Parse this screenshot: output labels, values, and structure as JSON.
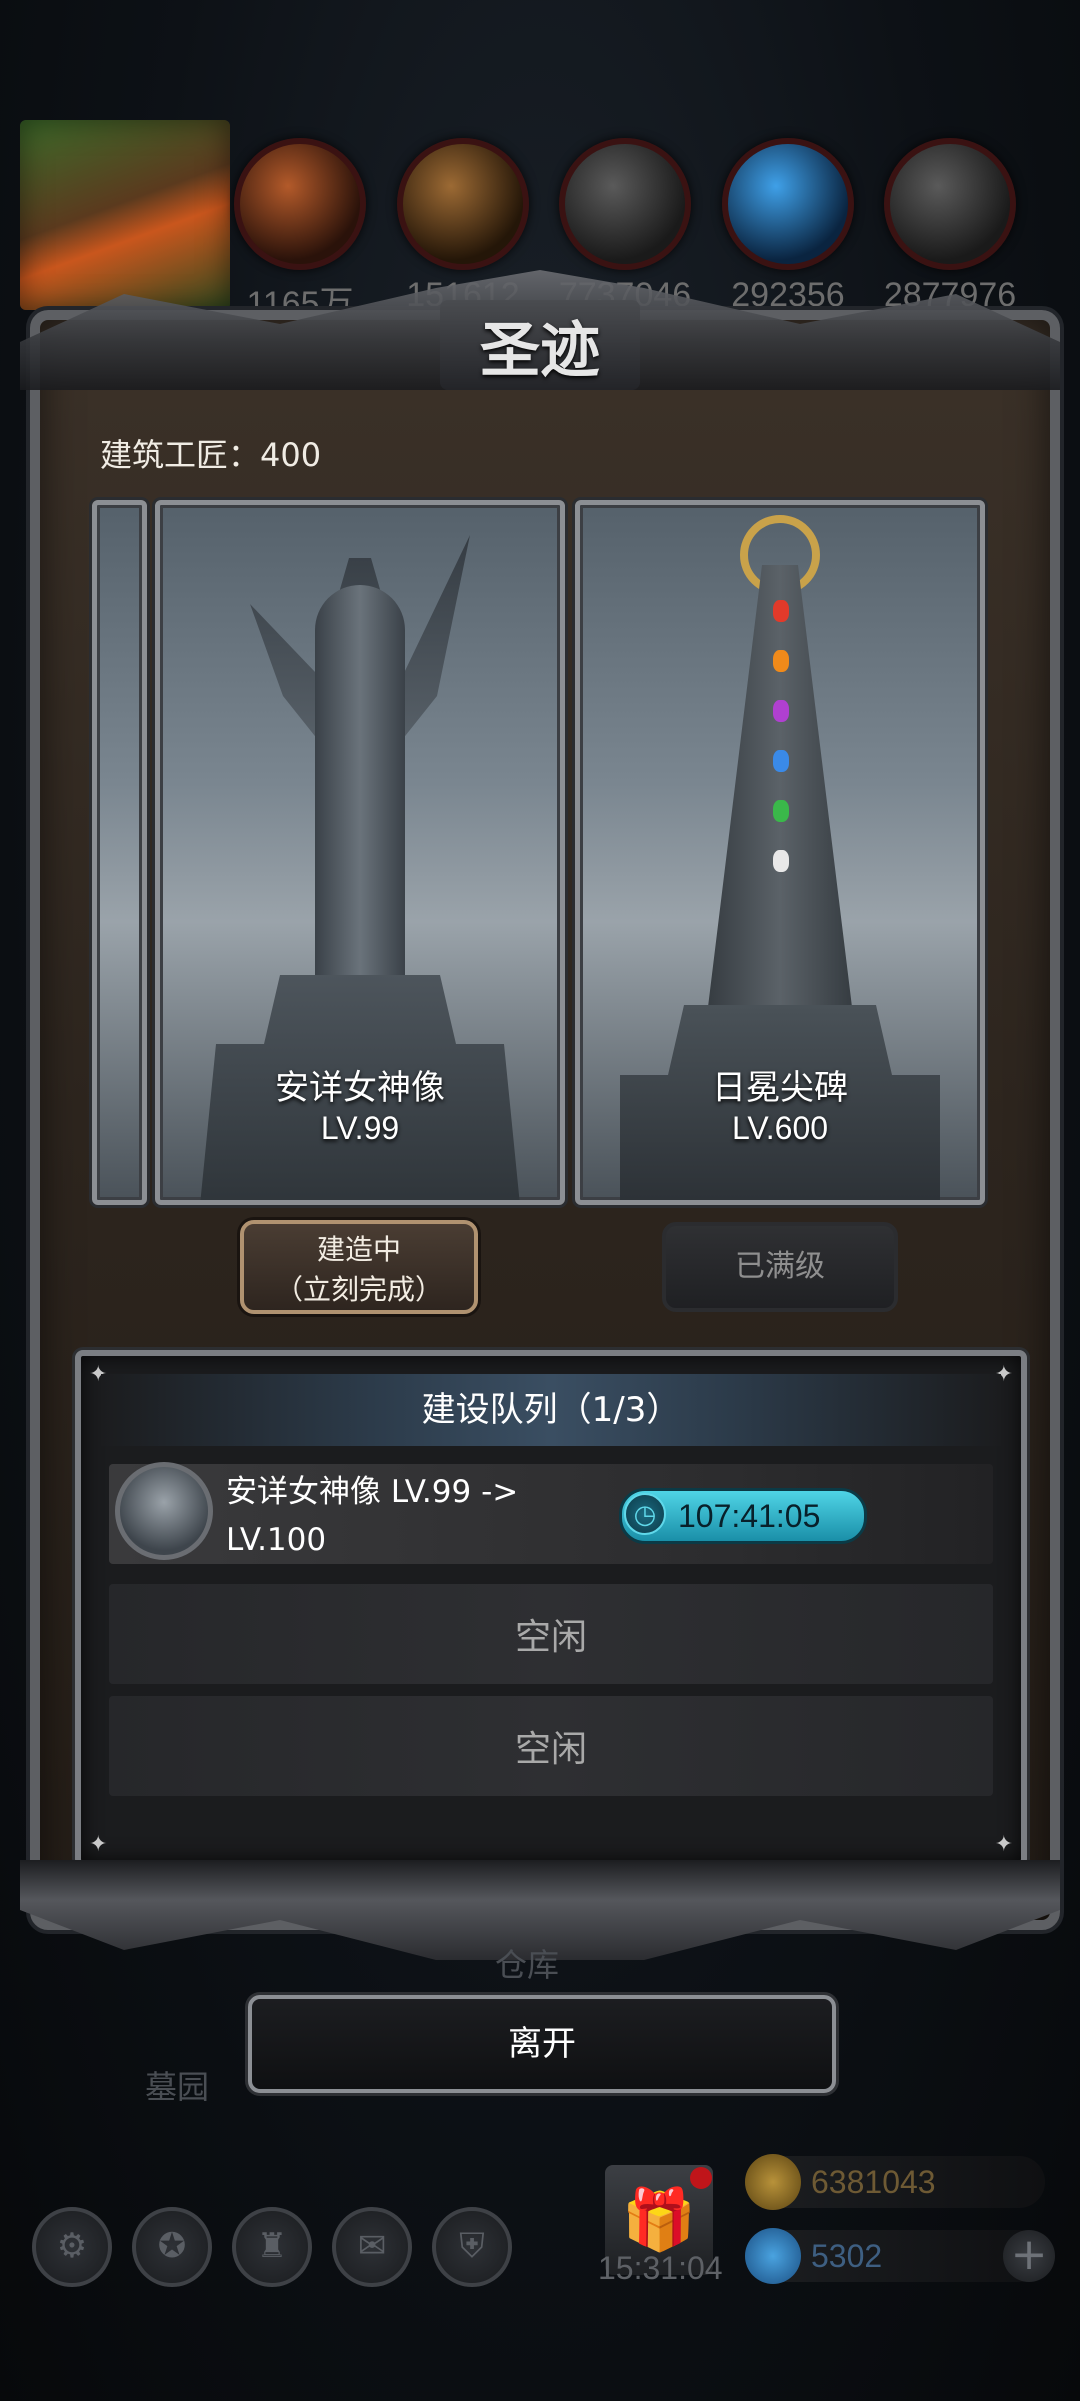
{
  "resources": [
    {
      "icon": "meat-icon",
      "value": "1165万"
    },
    {
      "icon": "wood-icon",
      "value": "151612"
    },
    {
      "icon": "stone-icon",
      "value": "7737046"
    },
    {
      "icon": "crystal-icon",
      "value": "292356"
    },
    {
      "icon": "iron-icon",
      "value": "2877976"
    }
  ],
  "panel": {
    "title": "圣迹",
    "builders_label": "建筑工匠：400"
  },
  "cards": [
    {
      "name": "安详女神像",
      "level": "LV.99",
      "action": {
        "line1": "建造中",
        "line2": "（立刻完成）"
      }
    },
    {
      "name": "日冕尖碑",
      "level": "LV.600",
      "action": {
        "label": "已满级"
      }
    }
  ],
  "queue": {
    "header": "建设队列（1/3）",
    "active": {
      "text": "安详女神像 LV.99 -> LV.100",
      "timer": "107:41:05"
    },
    "idle_label_1": "空闲",
    "idle_label_2": "空闲"
  },
  "leave_label": "离开",
  "background_labels": {
    "warehouse": "仓库",
    "cemetery": "墓园"
  },
  "hud": {
    "clock": "15:31:04",
    "gold": "6381043",
    "gems": "5302"
  },
  "colors": {
    "timer_cyan": "#4fd4e6",
    "gift_badge": "#c0151a",
    "obelisk_gold": "#c9a24a"
  }
}
